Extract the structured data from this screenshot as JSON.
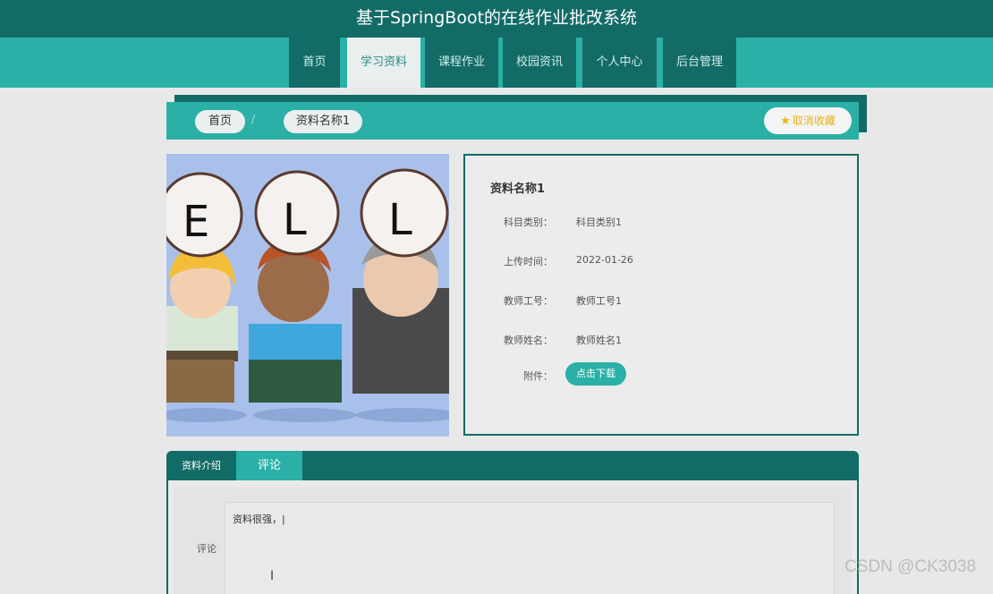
{
  "header": {
    "title": "基于SpringBoot的在线作业批改系统"
  },
  "nav": {
    "items": [
      {
        "label": "首页"
      },
      {
        "label": "学习资料",
        "active": true
      },
      {
        "label": "课程作业"
      },
      {
        "label": "校园资讯"
      },
      {
        "label": "个人中心"
      },
      {
        "label": "后台管理"
      }
    ]
  },
  "breadcrumb": {
    "home": "首页",
    "separator": "/",
    "current": "资料名称1",
    "favorite_label": "取消收藏",
    "favorite_icon": "star-icon"
  },
  "detail": {
    "title": "资料名称1",
    "fields": [
      {
        "label": "科目类别：",
        "value": "科目类别1"
      },
      {
        "label": "上传时间：",
        "value": "2022-01-26"
      },
      {
        "label": "教师工号：",
        "value": "教师工号1"
      },
      {
        "label": "教师姓名：",
        "value": "教师姓名1"
      }
    ],
    "attachment_label": "附件：",
    "download_label": "点击下载"
  },
  "tabs": {
    "items": [
      {
        "label": "资料介绍"
      },
      {
        "label": "评论",
        "active": true
      }
    ]
  },
  "comment": {
    "label": "评论",
    "value": "资料很强，|"
  },
  "watermark": "CSDN @CK3038",
  "colors": {
    "primary_dark": "#136b67",
    "primary": "#2ab0a6",
    "favorite": "#e7b21a"
  }
}
